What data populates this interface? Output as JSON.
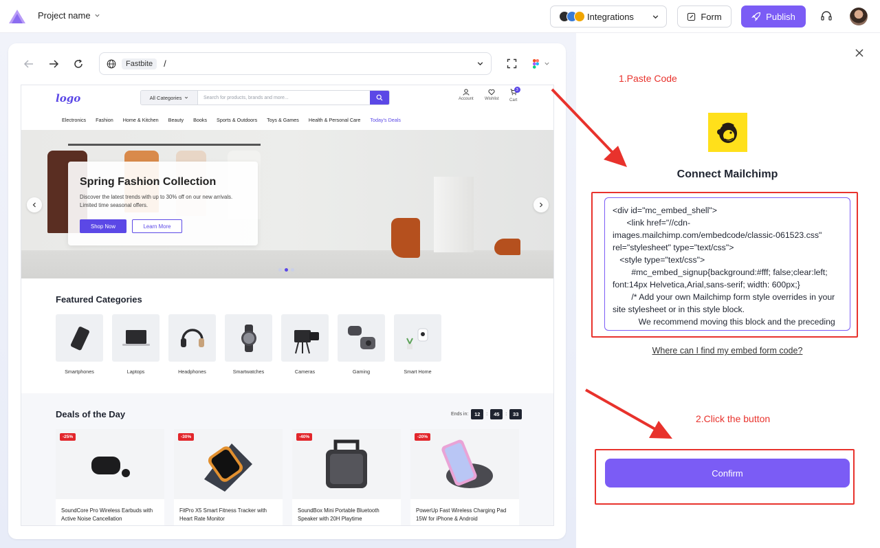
{
  "topbar": {
    "project_name": "Project name",
    "integrations_label": "Integrations",
    "form_label": "Form",
    "publish_label": "Publish"
  },
  "browser": {
    "site_label": "Fastbite",
    "path": "/"
  },
  "site": {
    "logo": "logo",
    "category_select": "All Categories",
    "search_placeholder": "Search for products, brands and more...",
    "account": "Account",
    "wishlist": "Wishlist",
    "cart": "Cart",
    "cart_count": "3",
    "menu": [
      "Electronics",
      "Fashion",
      "Home & Kitchen",
      "Beauty",
      "Books",
      "Sports & Outdoors",
      "Toys & Games",
      "Health & Personal Care",
      "Today's Deals"
    ],
    "hero": {
      "title": "Spring Fashion Collection",
      "subtitle": "Discover the latest trends with up to 30% off on our new arrivals. Limited time seasonal offers.",
      "shop_now": "Shop Now",
      "learn_more": "Learn More"
    },
    "featured_title": "Featured Categories",
    "categories": [
      "Smartphones",
      "Laptops",
      "Headphones",
      "Smartwatches",
      "Cameras",
      "Gaming",
      "Smart Home"
    ],
    "deals_title": "Deals of the Day",
    "ends_in": "Ends in:",
    "timer": [
      "12",
      "45",
      "33"
    ],
    "products": [
      {
        "discount": "-25%",
        "name": "SoundCore Pro Wireless Earbuds with Active Noise Cancellation"
      },
      {
        "discount": "-30%",
        "name": "FitPro X5 Smart Fitness Tracker with Heart Rate Monitor"
      },
      {
        "discount": "-40%",
        "name": "SoundBox Mini Portable Bluetooth Speaker with 20H Playtime"
      },
      {
        "discount": "-20%",
        "name": "PowerUp Fast Wireless Charging Pad 15W for iPhone & Android"
      }
    ]
  },
  "panel": {
    "step1": "1.Paste Code",
    "step2": "2.Click the button",
    "title": "Connect Mailchimp",
    "code": "<div id=\"mc_embed_shell\">\n      <link href=\"//cdn-images.mailchimp.com/embedcode/classic-061523.css\" rel=\"stylesheet\" type=\"text/css\">\n   <style type=\"text/css\">\n        #mc_embed_signup{background:#fff; false;clear:left; font:14px Helvetica,Arial,sans-serif; width: 600px;}\n        /* Add your own Mailchimp form style overrides in your site stylesheet or in this style block.\n           We recommend moving this block and the preceding CSS link to the HEAD of your HTML file. */…",
    "embed_link": "Where can I find my embed form code?",
    "confirm": "Confirm"
  },
  "colors": {
    "accent": "#7b5cf5",
    "site_accent": "#5b48e6",
    "annotation_red": "#e8322c",
    "mailchimp_yellow": "#ffe01b"
  }
}
